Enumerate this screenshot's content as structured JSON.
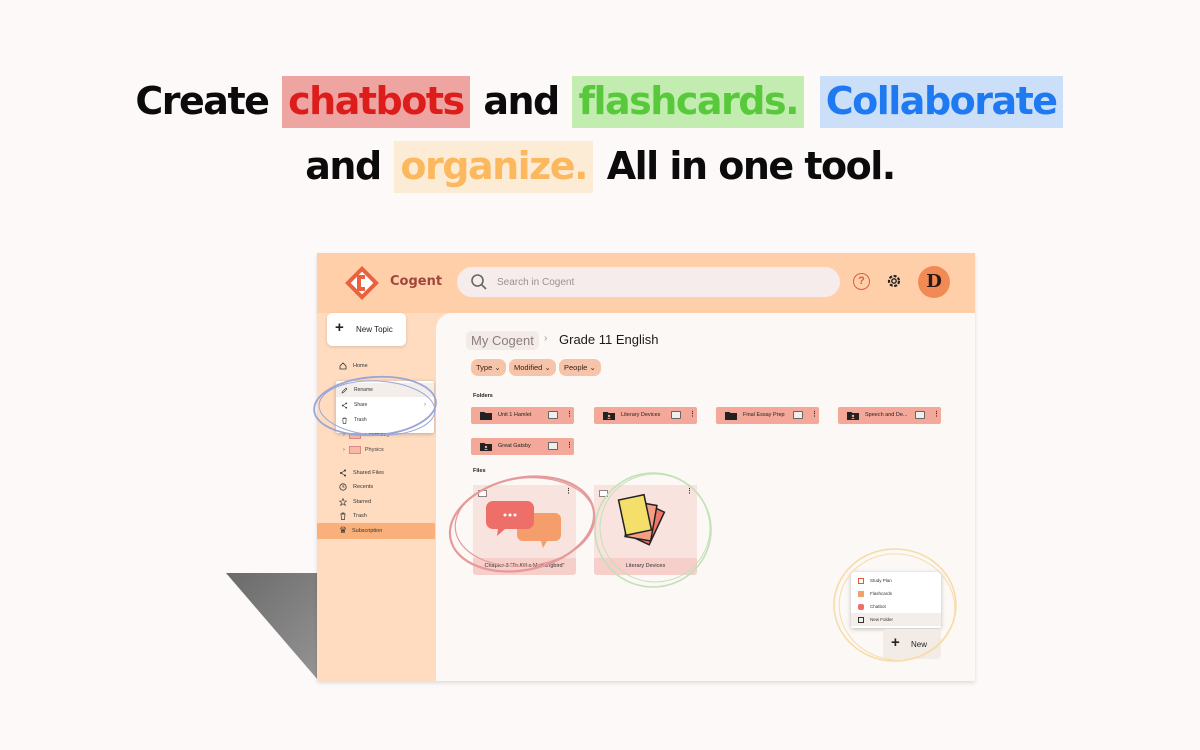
{
  "headline": {
    "line1": {
      "w1": "Create",
      "w2": "chatbots",
      "w3": "and",
      "w4": "flashcards.",
      "w5": "Collaborate"
    },
    "line2": {
      "w1": "and",
      "w2": "organize.",
      "w3": "All in one tool."
    }
  },
  "app": {
    "brand": "Cogent",
    "search_placeholder": "Search in Cogent",
    "help": "?",
    "avatar": "D"
  },
  "sidebar": {
    "new_topic": "New Topic",
    "home": "Home",
    "context_menu": {
      "rename": "Rename",
      "share": "Share",
      "trash": "Trash"
    },
    "subjects": [
      {
        "label": "Chemistry"
      },
      {
        "label": "Physics"
      }
    ],
    "shared": "Shared Files",
    "recents": "Recents",
    "starred": "Starred",
    "trash": "Trash",
    "subscription": "Subscription"
  },
  "main": {
    "breadcrumb_root": "My Cogent",
    "breadcrumb_current": "Grade 11 English",
    "filters": [
      "Type",
      "Modified",
      "People"
    ],
    "folders_title": "Folders",
    "folders": [
      {
        "label": "Unit 1 Hamlet"
      },
      {
        "label": "Literary Devices"
      },
      {
        "label": "Final Essay Prep"
      },
      {
        "label": "Speech and De..."
      },
      {
        "label": "Great Gatsby"
      }
    ],
    "files_title": "Files",
    "files": [
      {
        "label": "Chapter 3 \"To Kill a Mockingbird\""
      },
      {
        "label": "Literary Devices"
      }
    ],
    "new_menu": {
      "study_plan": "Study Plan",
      "flashcards": "Flashcards",
      "chatbot": "Chatbot",
      "new_folder": "New Folder"
    },
    "new_button": "New"
  },
  "colors": {
    "chatbots": "#dd1d1b",
    "flashcards": "#57c93b",
    "collaborate": "#1f7af1",
    "organize": "#fbb85f",
    "topbar": "#ffcfaa",
    "sidebar": "#ffdcc0"
  }
}
